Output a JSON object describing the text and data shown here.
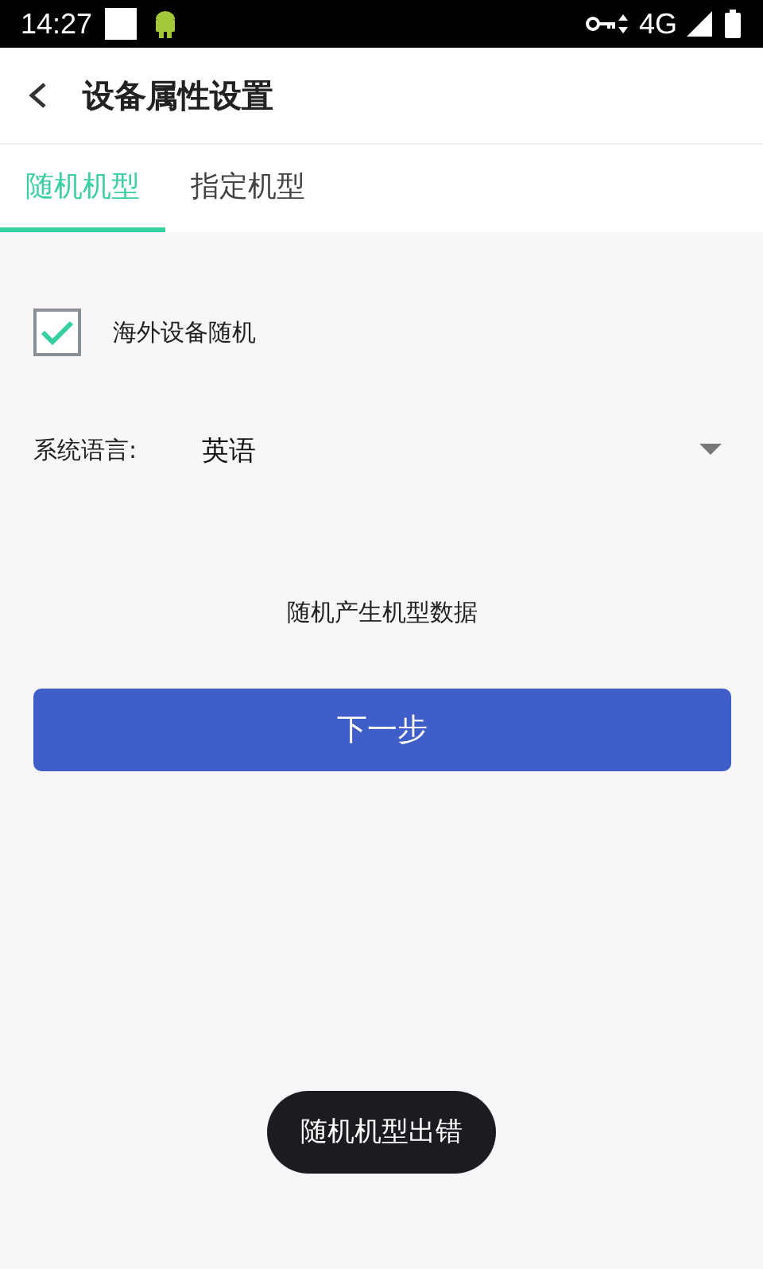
{
  "status_bar": {
    "time": "14:27",
    "network": "4G"
  },
  "header": {
    "title": "设备属性设置"
  },
  "tabs": [
    {
      "label": "随机机型",
      "selected": true
    },
    {
      "label": "指定机型",
      "selected": false
    }
  ],
  "overseas_option": {
    "label": "海外设备随机",
    "checked": true
  },
  "language": {
    "label": "系统语言:",
    "value": "英语"
  },
  "message": "随机产生机型数据",
  "next_button": "下一步",
  "toast": "随机机型出错"
}
